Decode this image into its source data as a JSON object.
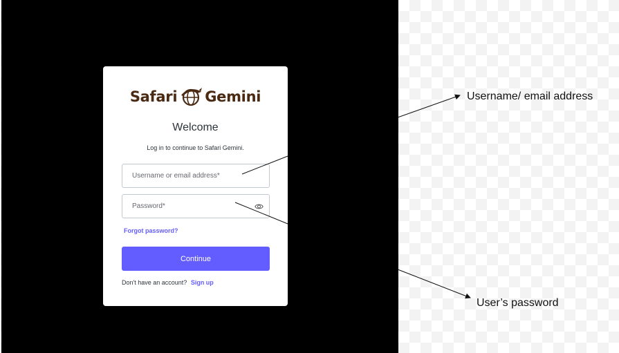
{
  "logo": {
    "left_text": "Safari",
    "right_text": "Gemini",
    "icon": "globe-mark-icon"
  },
  "login": {
    "title": "Welcome",
    "subtitle": "Log in to continue to Safari Gemini.",
    "username_placeholder": "Username or email address*",
    "password_placeholder": "Password*",
    "forgot_label": "Forgot password?",
    "continue_label": "Continue",
    "no_account_text": "Don't have an account?",
    "signup_label": "Sign up"
  },
  "annotations": {
    "username": "Username/ email address",
    "password": "User’s  password"
  },
  "colors": {
    "accent": "#635dff",
    "brand": "#4a2a12",
    "backdrop": "#000000"
  }
}
